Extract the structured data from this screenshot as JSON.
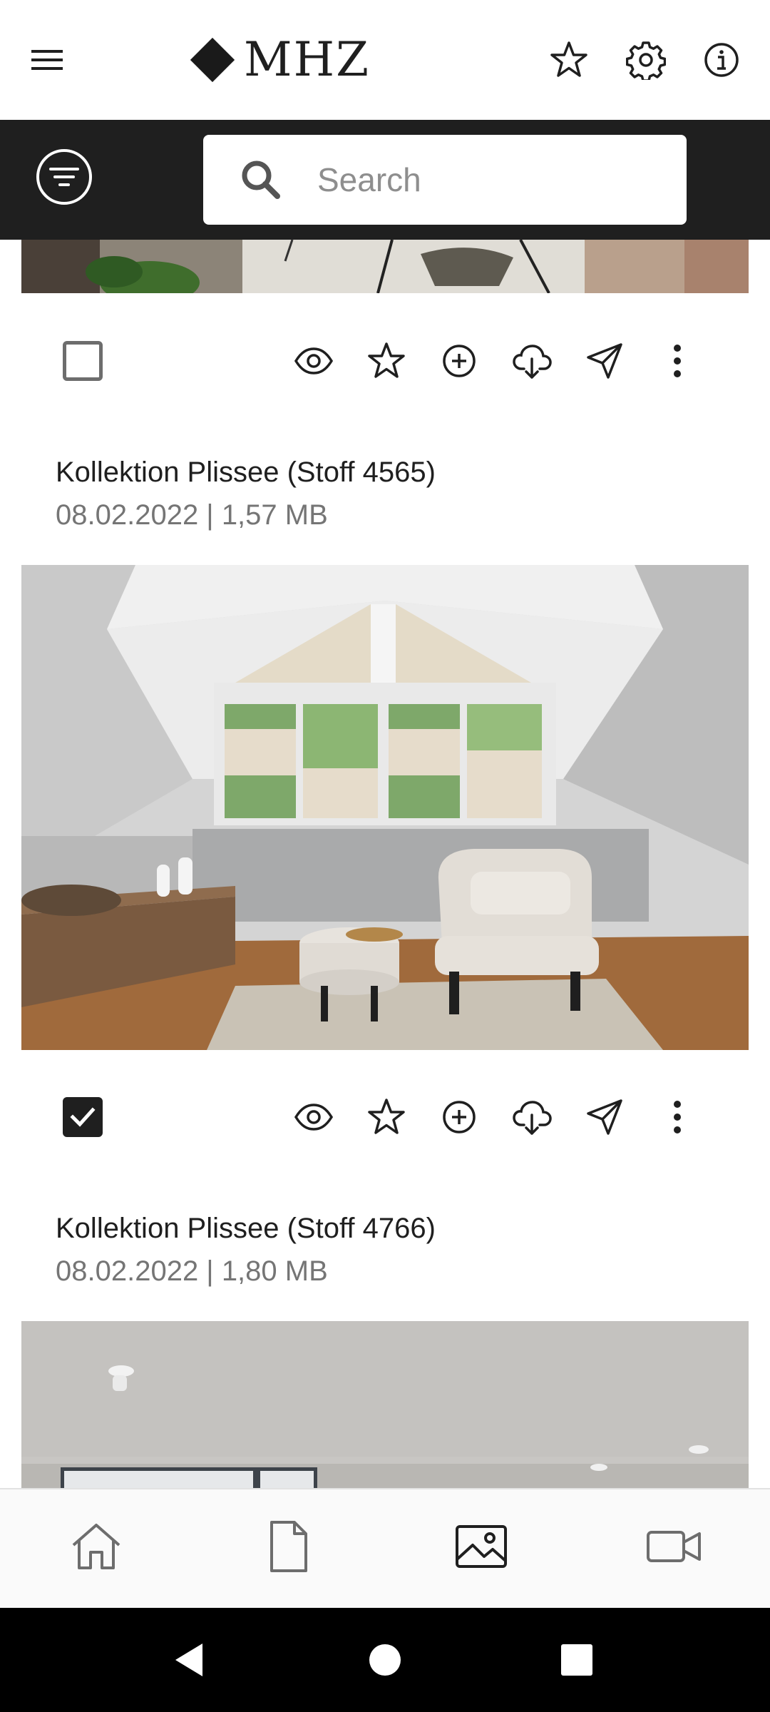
{
  "app": {
    "brand": "MHZ",
    "menu_icon": "hamburger-menu-icon",
    "favorites_icon": "star-icon",
    "settings_icon": "gear-icon",
    "info_icon": "info-icon"
  },
  "search": {
    "placeholder": "Search",
    "value": "",
    "filter_icon": "filter-icon",
    "search_icon": "search-icon"
  },
  "colors": {
    "header_bg": "#ffffff",
    "search_bar_bg": "#1f1f1f",
    "text_primary": "#1f1f1f",
    "text_secondary": "#757575",
    "nav_bg": "#fafafa",
    "system_bar_bg": "#000000"
  },
  "media_items": [
    {
      "title": "",
      "meta": "",
      "selected": false,
      "actions": [
        "preview-eye-icon",
        "favorite-star-icon",
        "add-plus-icon",
        "download-cloud-icon",
        "share-send-icon",
        "more-vertical-icon"
      ]
    },
    {
      "title": "Kollektion Plissee (Stoff 4565)",
      "meta": "08.02.2022 | 1,57 MB",
      "selected": true,
      "actions": [
        "preview-eye-icon",
        "favorite-star-icon",
        "add-plus-icon",
        "download-cloud-icon",
        "share-send-icon",
        "more-vertical-icon"
      ]
    },
    {
      "title": "Kollektion Plissee (Stoff 4766)",
      "meta": "08.02.2022 | 1,80 MB",
      "selected": false,
      "actions": []
    }
  ],
  "bottom_nav": {
    "items": [
      {
        "icon": "home-icon",
        "active": false
      },
      {
        "icon": "document-icon",
        "active": false
      },
      {
        "icon": "image-gallery-icon",
        "active": true
      },
      {
        "icon": "video-camera-icon",
        "active": false
      }
    ]
  },
  "system_nav": {
    "items": [
      "back-triangle-icon",
      "home-circle-icon",
      "recents-square-icon"
    ]
  }
}
